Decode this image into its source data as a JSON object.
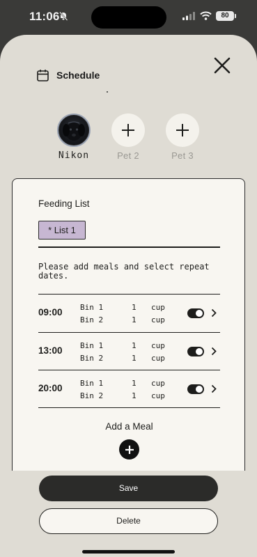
{
  "status_bar": {
    "time": "11:06",
    "battery": "80",
    "icons": [
      "bell-slash-icon",
      "signal-icon",
      "wifi-icon",
      "battery-icon"
    ]
  },
  "header": {
    "title": "Schedule",
    "icon": "calendar-icon",
    "close_icon": "close-icon"
  },
  "pets": [
    {
      "name": "Nikon",
      "type": "photo"
    },
    {
      "name": "Pet 2",
      "type": "add"
    },
    {
      "name": "Pet 3",
      "type": "add"
    }
  ],
  "feeding": {
    "title": "Feeding List",
    "active_list": "* List 1",
    "info": "Please add meals and select repeat dates.",
    "meals": [
      {
        "time": "09:00",
        "bins": [
          {
            "name": "Bin 1",
            "qty": "1",
            "unit": "cup"
          },
          {
            "name": "Bin 2",
            "qty": "1",
            "unit": "cup"
          }
        ],
        "enabled": true
      },
      {
        "time": "13:00",
        "bins": [
          {
            "name": "Bin 1",
            "qty": "1",
            "unit": "cup"
          },
          {
            "name": "Bin 2",
            "qty": "1",
            "unit": "cup"
          }
        ],
        "enabled": true
      },
      {
        "time": "20:00",
        "bins": [
          {
            "name": "Bin 1",
            "qty": "1",
            "unit": "cup"
          },
          {
            "name": "Bin 2",
            "qty": "1",
            "unit": "cup"
          }
        ],
        "enabled": true
      }
    ],
    "add_meal_label": "Add a Meal"
  },
  "actions": {
    "save_label": "Save",
    "delete_label": "Delete"
  },
  "colors": {
    "sheet_bg": "#dfdcd4",
    "card_bg": "#f8f6f1",
    "chip_bg": "#c7b7d2",
    "dark": "#2b2b29"
  }
}
